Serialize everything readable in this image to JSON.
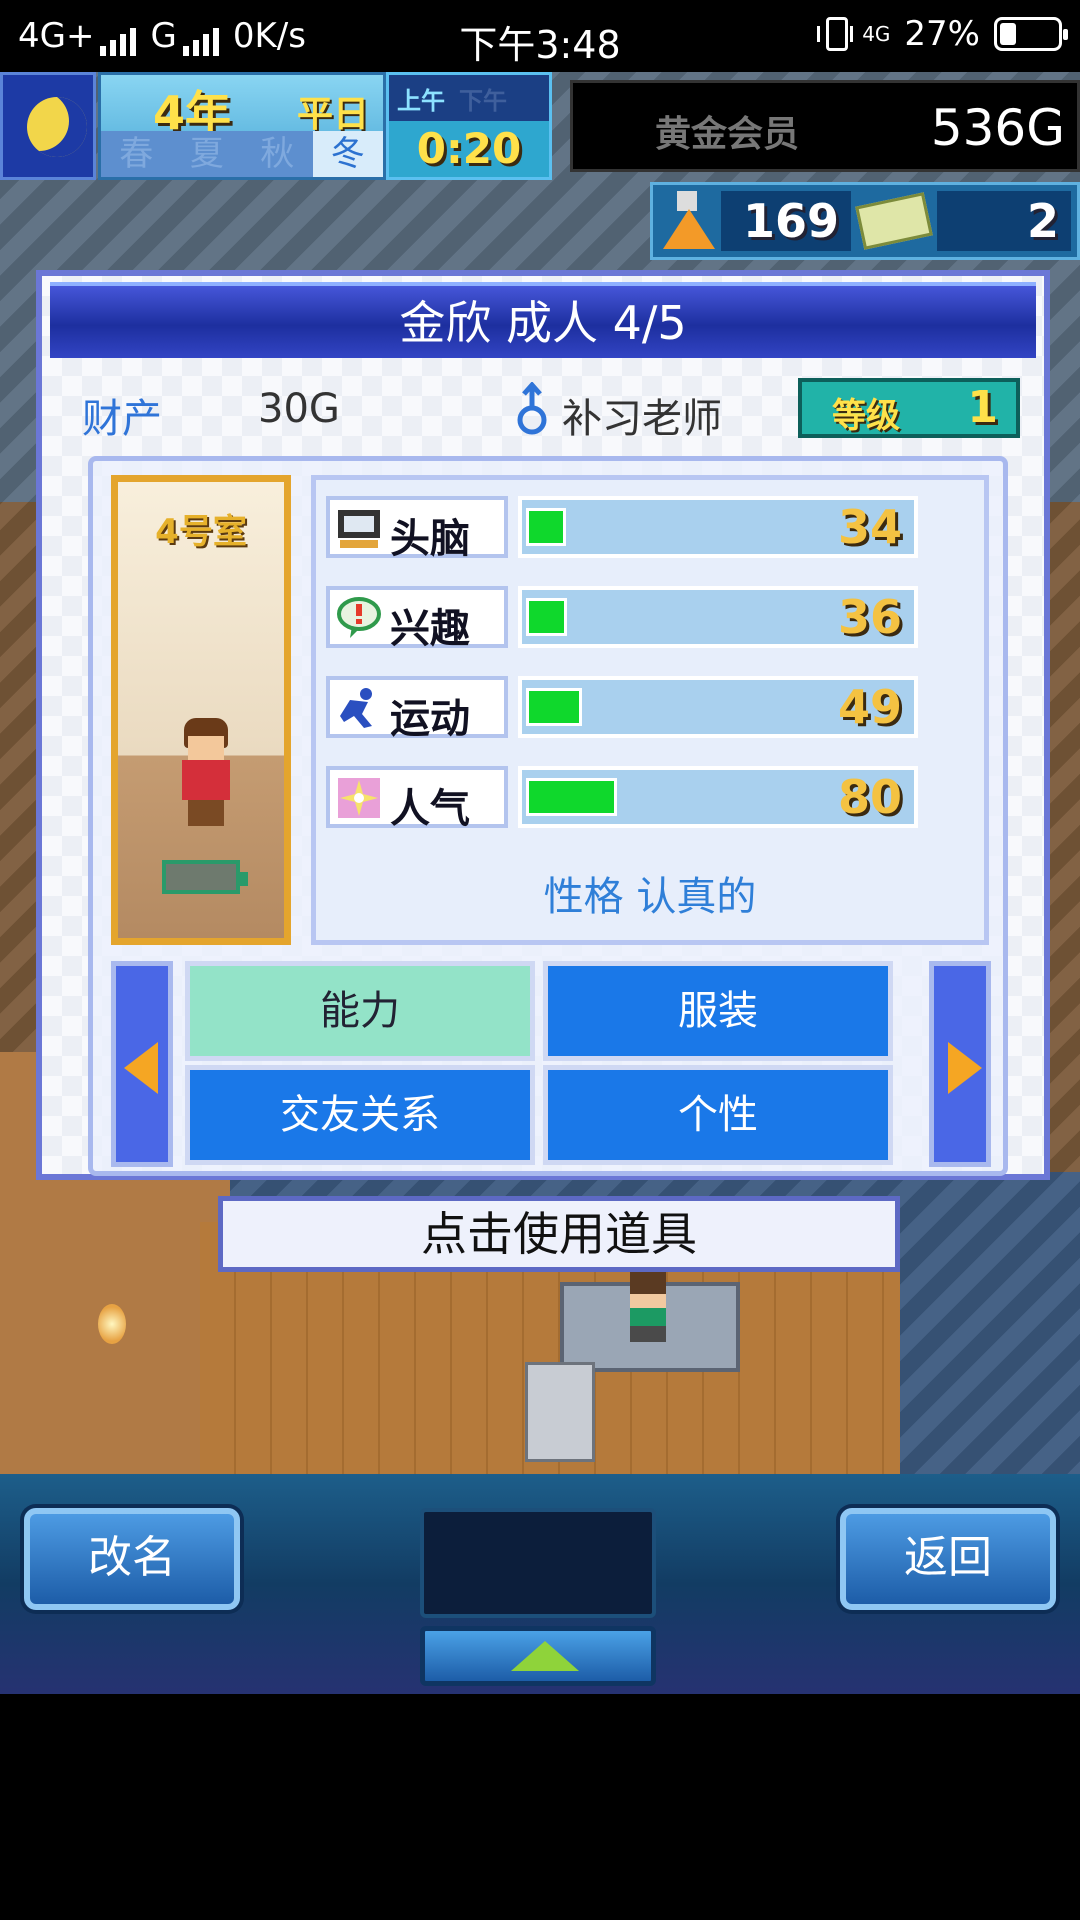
{
  "status_bar": {
    "network_left": "4G+",
    "network_mid": "G",
    "speed": "0K/s",
    "time": "下午3:48",
    "network_right": "4G",
    "battery": "27%"
  },
  "hud": {
    "year": "4年",
    "weekday": "平日",
    "seasons": [
      "春",
      "夏",
      "秋",
      "冬"
    ],
    "active_season_index": 3,
    "am": "上午",
    "pm": "下午",
    "clock": "0:20",
    "vip_label": "黄金会员",
    "gold": "536G",
    "research_points": "169",
    "tickets": "2"
  },
  "panel": {
    "title": "金欣 成人 4/5",
    "assets_label": "财产",
    "assets_value": "30G",
    "job": "补习老师",
    "level_label": "等级",
    "level_value": "1",
    "room_label": "4号室",
    "stats": [
      {
        "name": "头脑",
        "value": "34",
        "icon": "brain-computer-icon"
      },
      {
        "name": "兴趣",
        "value": "36",
        "icon": "interest-bubble-icon"
      },
      {
        "name": "运动",
        "value": "49",
        "icon": "sports-runner-icon"
      },
      {
        "name": "人气",
        "value": "80",
        "icon": "popularity-sparkle-icon"
      }
    ],
    "personality": "性格 认真的",
    "tabs": [
      "能力",
      "服装",
      "交友关系",
      "个性"
    ]
  },
  "use_item_label": "点击使用道具",
  "bottom": {
    "rename_label": "改名",
    "back_label": "返回"
  },
  "colors": {
    "panel_title_bg": "#1d2f9f",
    "tab_active": "#93e3c8",
    "tab_inactive": "#1a78e8",
    "stat_fill": "#0fd82c",
    "stat_value": "#f4c242"
  }
}
